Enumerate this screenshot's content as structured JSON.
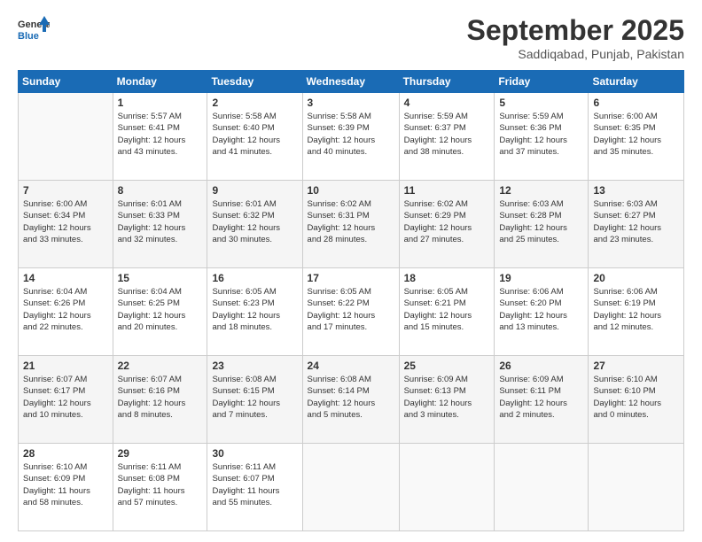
{
  "logo": {
    "text_general": "General",
    "text_blue": "Blue"
  },
  "header": {
    "month": "September 2025",
    "location": "Saddiqabad, Punjab, Pakistan"
  },
  "days_of_week": [
    "Sunday",
    "Monday",
    "Tuesday",
    "Wednesday",
    "Thursday",
    "Friday",
    "Saturday"
  ],
  "weeks": [
    [
      {
        "day": "",
        "info": ""
      },
      {
        "day": "1",
        "info": "Sunrise: 5:57 AM\nSunset: 6:41 PM\nDaylight: 12 hours\nand 43 minutes."
      },
      {
        "day": "2",
        "info": "Sunrise: 5:58 AM\nSunset: 6:40 PM\nDaylight: 12 hours\nand 41 minutes."
      },
      {
        "day": "3",
        "info": "Sunrise: 5:58 AM\nSunset: 6:39 PM\nDaylight: 12 hours\nand 40 minutes."
      },
      {
        "day": "4",
        "info": "Sunrise: 5:59 AM\nSunset: 6:37 PM\nDaylight: 12 hours\nand 38 minutes."
      },
      {
        "day": "5",
        "info": "Sunrise: 5:59 AM\nSunset: 6:36 PM\nDaylight: 12 hours\nand 37 minutes."
      },
      {
        "day": "6",
        "info": "Sunrise: 6:00 AM\nSunset: 6:35 PM\nDaylight: 12 hours\nand 35 minutes."
      }
    ],
    [
      {
        "day": "7",
        "info": "Sunrise: 6:00 AM\nSunset: 6:34 PM\nDaylight: 12 hours\nand 33 minutes."
      },
      {
        "day": "8",
        "info": "Sunrise: 6:01 AM\nSunset: 6:33 PM\nDaylight: 12 hours\nand 32 minutes."
      },
      {
        "day": "9",
        "info": "Sunrise: 6:01 AM\nSunset: 6:32 PM\nDaylight: 12 hours\nand 30 minutes."
      },
      {
        "day": "10",
        "info": "Sunrise: 6:02 AM\nSunset: 6:31 PM\nDaylight: 12 hours\nand 28 minutes."
      },
      {
        "day": "11",
        "info": "Sunrise: 6:02 AM\nSunset: 6:29 PM\nDaylight: 12 hours\nand 27 minutes."
      },
      {
        "day": "12",
        "info": "Sunrise: 6:03 AM\nSunset: 6:28 PM\nDaylight: 12 hours\nand 25 minutes."
      },
      {
        "day": "13",
        "info": "Sunrise: 6:03 AM\nSunset: 6:27 PM\nDaylight: 12 hours\nand 23 minutes."
      }
    ],
    [
      {
        "day": "14",
        "info": "Sunrise: 6:04 AM\nSunset: 6:26 PM\nDaylight: 12 hours\nand 22 minutes."
      },
      {
        "day": "15",
        "info": "Sunrise: 6:04 AM\nSunset: 6:25 PM\nDaylight: 12 hours\nand 20 minutes."
      },
      {
        "day": "16",
        "info": "Sunrise: 6:05 AM\nSunset: 6:23 PM\nDaylight: 12 hours\nand 18 minutes."
      },
      {
        "day": "17",
        "info": "Sunrise: 6:05 AM\nSunset: 6:22 PM\nDaylight: 12 hours\nand 17 minutes."
      },
      {
        "day": "18",
        "info": "Sunrise: 6:05 AM\nSunset: 6:21 PM\nDaylight: 12 hours\nand 15 minutes."
      },
      {
        "day": "19",
        "info": "Sunrise: 6:06 AM\nSunset: 6:20 PM\nDaylight: 12 hours\nand 13 minutes."
      },
      {
        "day": "20",
        "info": "Sunrise: 6:06 AM\nSunset: 6:19 PM\nDaylight: 12 hours\nand 12 minutes."
      }
    ],
    [
      {
        "day": "21",
        "info": "Sunrise: 6:07 AM\nSunset: 6:17 PM\nDaylight: 12 hours\nand 10 minutes."
      },
      {
        "day": "22",
        "info": "Sunrise: 6:07 AM\nSunset: 6:16 PM\nDaylight: 12 hours\nand 8 minutes."
      },
      {
        "day": "23",
        "info": "Sunrise: 6:08 AM\nSunset: 6:15 PM\nDaylight: 12 hours\nand 7 minutes."
      },
      {
        "day": "24",
        "info": "Sunrise: 6:08 AM\nSunset: 6:14 PM\nDaylight: 12 hours\nand 5 minutes."
      },
      {
        "day": "25",
        "info": "Sunrise: 6:09 AM\nSunset: 6:13 PM\nDaylight: 12 hours\nand 3 minutes."
      },
      {
        "day": "26",
        "info": "Sunrise: 6:09 AM\nSunset: 6:11 PM\nDaylight: 12 hours\nand 2 minutes."
      },
      {
        "day": "27",
        "info": "Sunrise: 6:10 AM\nSunset: 6:10 PM\nDaylight: 12 hours\nand 0 minutes."
      }
    ],
    [
      {
        "day": "28",
        "info": "Sunrise: 6:10 AM\nSunset: 6:09 PM\nDaylight: 11 hours\nand 58 minutes."
      },
      {
        "day": "29",
        "info": "Sunrise: 6:11 AM\nSunset: 6:08 PM\nDaylight: 11 hours\nand 57 minutes."
      },
      {
        "day": "30",
        "info": "Sunrise: 6:11 AM\nSunset: 6:07 PM\nDaylight: 11 hours\nand 55 minutes."
      },
      {
        "day": "",
        "info": ""
      },
      {
        "day": "",
        "info": ""
      },
      {
        "day": "",
        "info": ""
      },
      {
        "day": "",
        "info": ""
      }
    ]
  ]
}
